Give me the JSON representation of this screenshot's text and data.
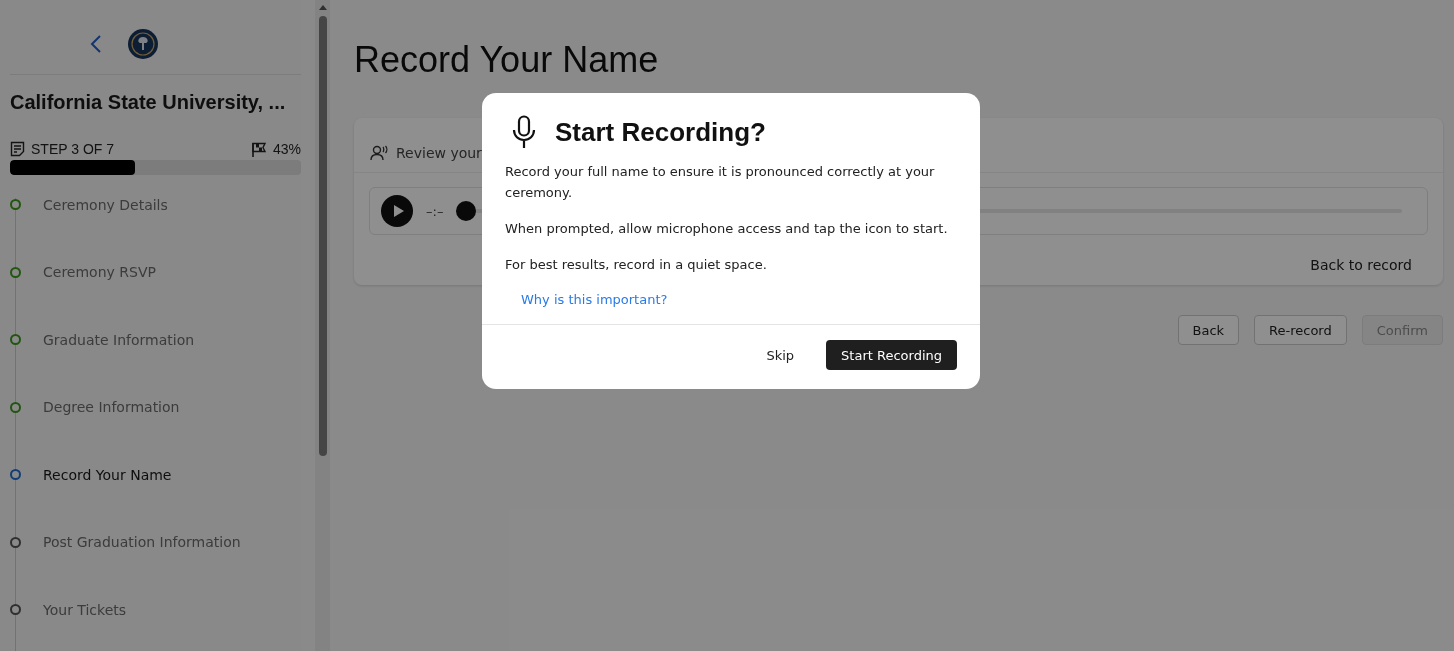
{
  "sidebar": {
    "university": "California State University, ...",
    "step_label": "STEP 3 OF 7",
    "percent": "43%",
    "progress": {
      "level": 0.43
    },
    "steps": [
      {
        "label": "Ceremony Details",
        "kind": "done"
      },
      {
        "label": "Ceremony RSVP",
        "kind": "done"
      },
      {
        "label": "Graduate Information",
        "kind": "done"
      },
      {
        "label": "Degree Information",
        "kind": "done"
      },
      {
        "label": "Record Your Name",
        "kind": "current"
      },
      {
        "label": "Post Graduation Information",
        "kind": "upcoming"
      },
      {
        "label": "Your Tickets",
        "kind": "upcoming"
      }
    ]
  },
  "page": {
    "title": "Record Your Name",
    "card": {
      "heading": "Review your",
      "player": {
        "time": "–:–",
        "level": 0
      },
      "link": "Back to record"
    },
    "buttons": [
      {
        "label": "Back",
        "disabled": false
      },
      {
        "label": "Re-record",
        "disabled": false
      },
      {
        "label": "Confirm",
        "disabled": true
      }
    ]
  },
  "dialog": {
    "title": "Start Recording?",
    "paragraphs": [
      "Record your full name to ensure it is pronounced correctly at your ceremony.",
      "When prompted, allow microphone access and tap the icon to start.",
      "For best results, record in a quiet space."
    ],
    "link": "Why is this important?",
    "secondary": "Skip",
    "primary": "Start Recording"
  }
}
